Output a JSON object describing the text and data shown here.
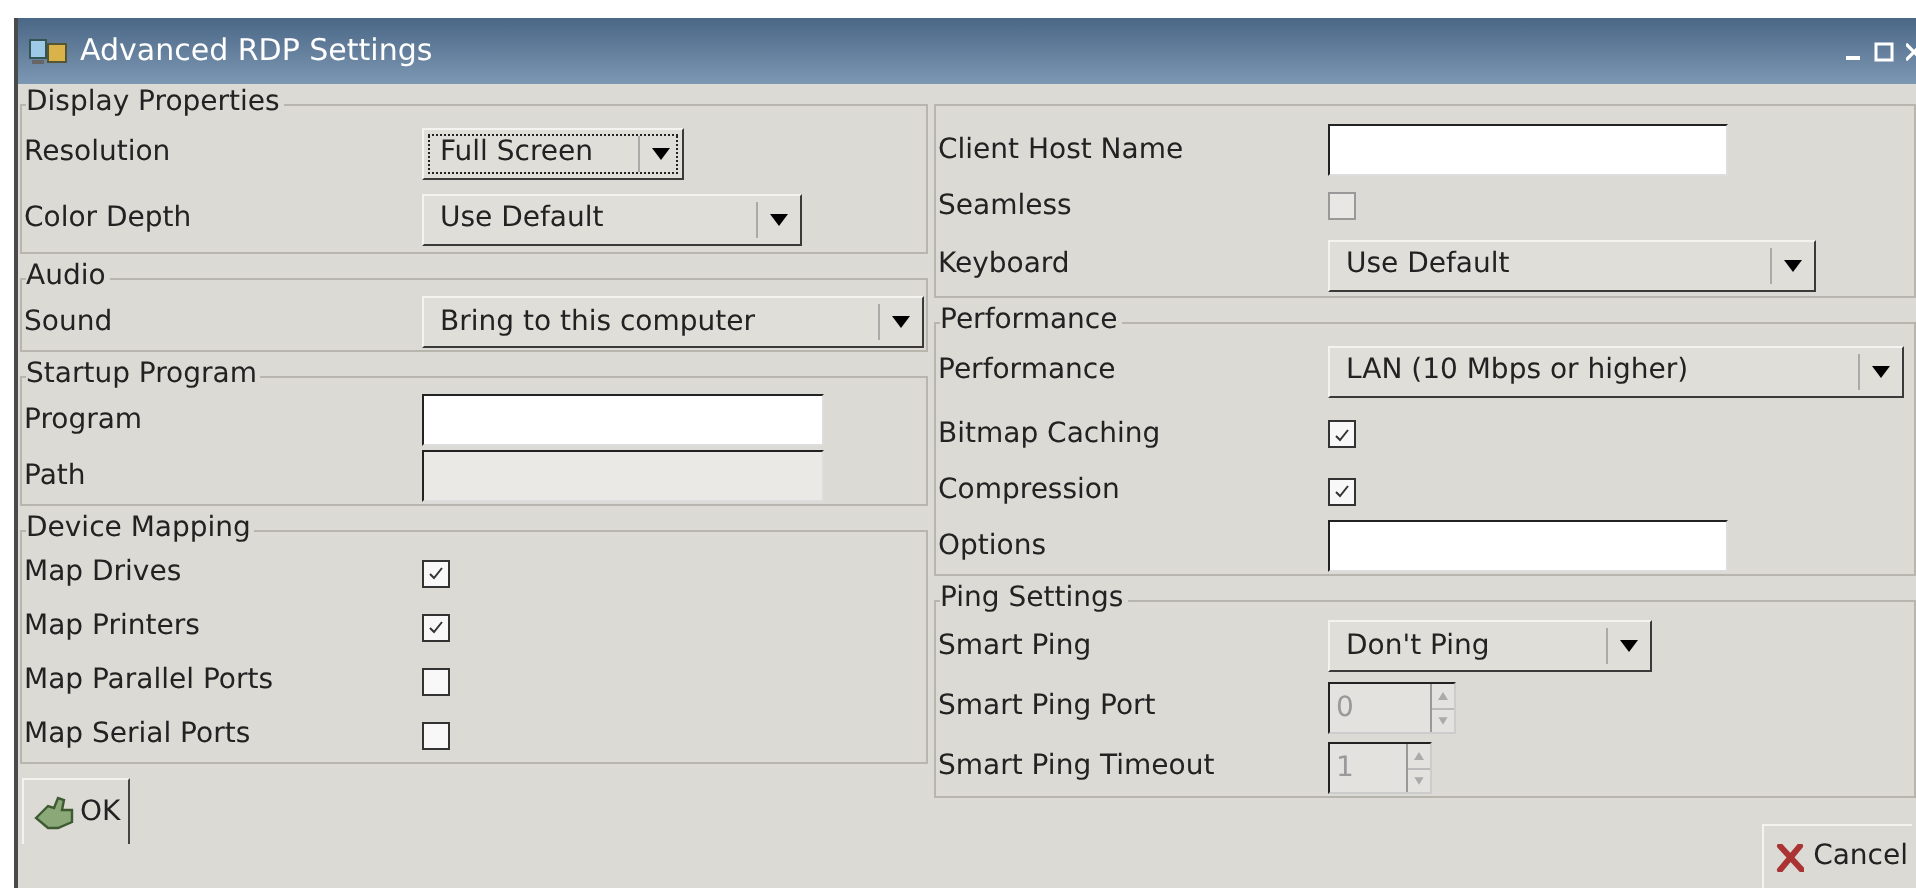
{
  "window": {
    "title": "Advanced RDP Settings"
  },
  "left_sections": [
    {
      "legend": "Display Properties",
      "rows": [
        {
          "kind": "dropdown",
          "label": "Resolution",
          "value": "Full Screen",
          "focused": true
        },
        {
          "kind": "dropdown",
          "label": "Color Depth",
          "value": "Use Default",
          "focused": false
        }
      ]
    },
    {
      "legend": "Audio",
      "rows": [
        {
          "kind": "dropdown",
          "label": "Sound",
          "value": "Bring to this computer",
          "focused": false
        }
      ]
    },
    {
      "legend": "Startup Program",
      "rows": [
        {
          "kind": "text",
          "label": "Program",
          "disabled": false
        },
        {
          "kind": "text",
          "label": "Path",
          "disabled": true
        }
      ]
    },
    {
      "legend": "Device Mapping",
      "rows": [
        {
          "kind": "checkbox",
          "label": "Map Drives",
          "checked": true
        },
        {
          "kind": "checkbox",
          "label": "Map Printers",
          "checked": true
        },
        {
          "kind": "checkbox",
          "label": "Map Parallel Ports",
          "checked": false
        },
        {
          "kind": "checkbox",
          "label": "Map Serial Ports",
          "checked": false
        }
      ]
    }
  ],
  "right_sections": [
    {
      "rows": [
        {
          "kind": "text",
          "label": "Client Host Name",
          "disabled": false
        },
        {
          "kind": "checkbox",
          "label": "Seamless",
          "checked": false,
          "disabled": true
        },
        {
          "kind": "dropdown",
          "label": "Keyboard",
          "value": "Use Default",
          "focused": false
        }
      ]
    },
    {
      "legend": "Performance",
      "rows": [
        {
          "kind": "dropdown",
          "label": "Performance",
          "value": "LAN (10 Mbps or higher)",
          "focused": false
        },
        {
          "kind": "checkbox",
          "label": "Bitmap Caching",
          "checked": true,
          "disabled": false
        },
        {
          "kind": "checkbox",
          "label": "Compression",
          "checked": true,
          "disabled": false
        },
        {
          "kind": "text",
          "label": "Options",
          "disabled": false
        }
      ]
    },
    {
      "legend": "Ping Settings",
      "rows": [
        {
          "kind": "dropdown",
          "label": "Smart Ping",
          "value": "Don't Ping",
          "focused": false
        },
        {
          "kind": "spin",
          "label": "Smart Ping Port",
          "value": "0",
          "disabled": true
        },
        {
          "kind": "spin",
          "label": "Smart Ping Timeout",
          "value": "1",
          "disabled": true
        }
      ]
    }
  ],
  "buttons": {
    "ok": "OK",
    "cancel": "Cancel"
  }
}
